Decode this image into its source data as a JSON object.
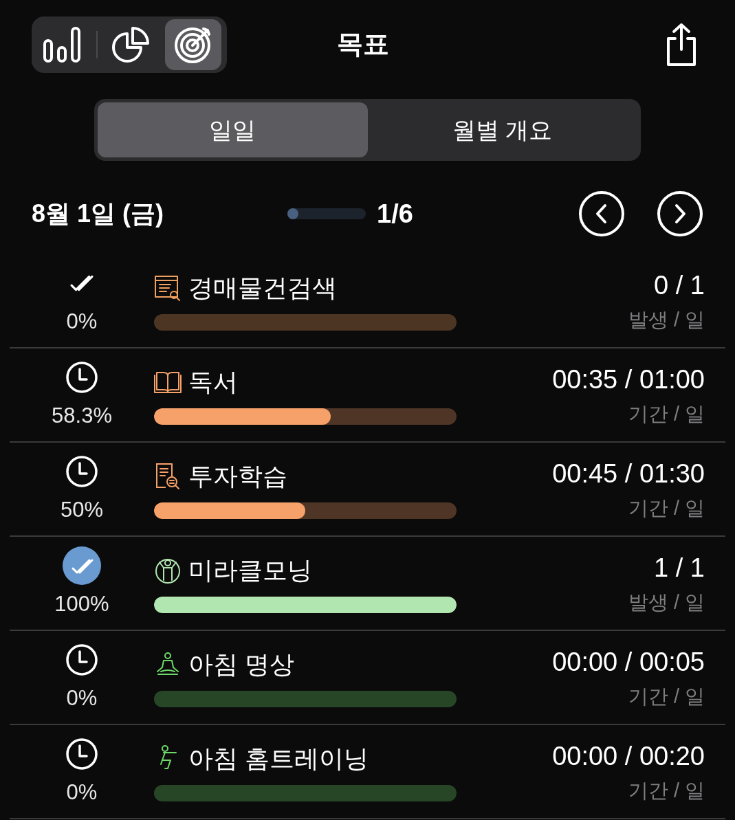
{
  "title": "목표",
  "view_switcher": [
    {
      "kind": "bars",
      "selected": false
    },
    {
      "kind": "pie",
      "selected": false
    },
    {
      "kind": "target",
      "selected": true
    }
  ],
  "tabs": [
    {
      "label": "일일",
      "selected": true
    },
    {
      "label": "월별 개요",
      "selected": false
    }
  ],
  "date": "8월 1일 (금)",
  "page_indicator": {
    "level": 0.14,
    "text": "1/6"
  },
  "goals": [
    {
      "kind": "count",
      "completed": false,
      "percent": "0%",
      "name": "경매물건검색",
      "value": "0 / 1",
      "unit": "발생 / 일",
      "level": 0,
      "color": "#f0a060"
    },
    {
      "kind": "time",
      "percent": "58.3%",
      "name": "독서",
      "value": "00:35 / 01:00",
      "unit": "기간 / 일",
      "level": 0.583,
      "color": "#f6a06a"
    },
    {
      "kind": "time",
      "percent": "50%",
      "name": "투자학습",
      "value": "00:45 / 01:30",
      "unit": "기간 / 일",
      "level": 0.5,
      "color": "#f6a06a"
    },
    {
      "kind": "count",
      "completed": true,
      "percent": "100%",
      "name": "미라클모닝",
      "value": "1 / 1",
      "unit": "발생 / 일",
      "level": 1,
      "color": "#b2e6b0"
    },
    {
      "kind": "time",
      "percent": "0%",
      "name": "아침 명상",
      "value": "00:00 / 00:05",
      "unit": "기간 / 일",
      "level": 0,
      "color": "#6fd86a"
    },
    {
      "kind": "time",
      "percent": "0%",
      "name": "아침 홈트레이닝",
      "value": "00:00 / 00:20",
      "unit": "기간 / 일",
      "level": 0,
      "color": "#6fd86a"
    }
  ]
}
